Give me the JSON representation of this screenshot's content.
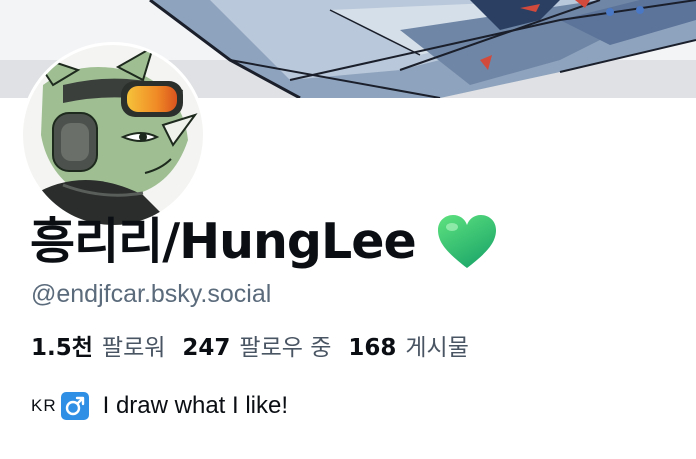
{
  "profile": {
    "display_name": "흥리리/HungLee",
    "handle": "@endjfcar.bsky.social",
    "name_emoji": "green-heart-icon",
    "stats": [
      {
        "value": "1.5천",
        "label": "팔로워"
      },
      {
        "value": "247",
        "label": "팔로우 중"
      },
      {
        "value": "168",
        "label": "게시물"
      }
    ],
    "bio": {
      "flag": "KR",
      "emoji": "male-sign-icon",
      "text": "I draw what I like!"
    }
  },
  "colors": {
    "text": "#0b0f14",
    "handle": "#5b6b7c",
    "secondary": "#4a5563",
    "heart": "#2ecc71",
    "male_sign_bg": "#2f8fe4"
  }
}
